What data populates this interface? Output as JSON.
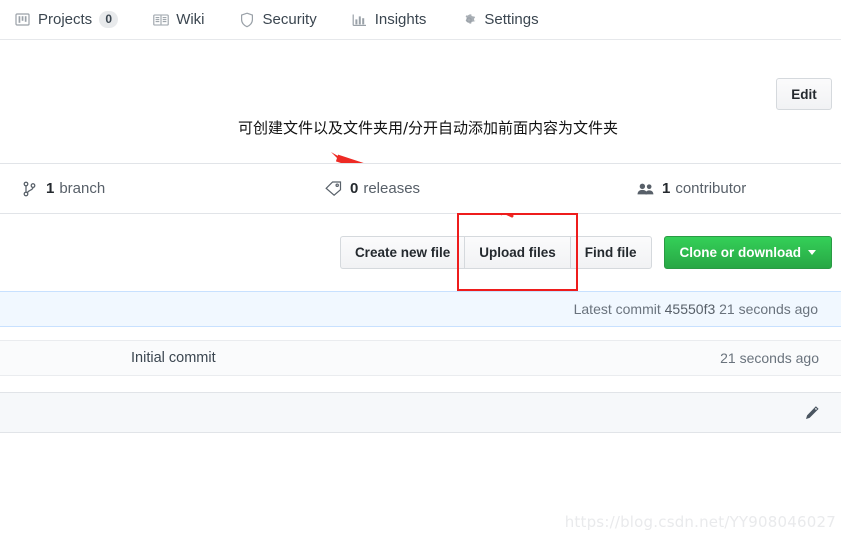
{
  "nav": {
    "items": [
      {
        "label": "Projects",
        "icon": "project-board-icon",
        "count": "0"
      },
      {
        "label": "Wiki",
        "icon": "book-icon"
      },
      {
        "label": "Security",
        "icon": "shield-icon"
      },
      {
        "label": "Insights",
        "icon": "graph-icon"
      },
      {
        "label": "Settings",
        "icon": "gear-icon"
      }
    ]
  },
  "toolbar": {
    "edit_label": "Edit"
  },
  "annotation": {
    "text": "可创建文件以及文件夹用/分开自动添加前面内容为文件夹",
    "arrow_color": "#ee2a24",
    "highlight_color": "#ee1c1c"
  },
  "numbers": {
    "branch": {
      "count": "1",
      "label": "branch",
      "icon": "git-branch-icon"
    },
    "releases": {
      "count": "0",
      "label": "releases",
      "icon": "tag-icon"
    },
    "contributors": {
      "count": "1",
      "label": "contributor",
      "icon": "people-icon"
    }
  },
  "actions": {
    "create_new_file": "Create new file",
    "upload_files": "Upload files",
    "find_file": "Find file",
    "clone_or_download": "Clone or download",
    "clone_button_color": "#28a745"
  },
  "commit": {
    "latest_prefix": "Latest commit",
    "sha": "45550f3",
    "latest_time": "21 seconds ago",
    "message": "Initial commit",
    "time": "21 seconds ago"
  },
  "readme": {
    "edit_icon": "pencil-icon"
  },
  "watermark": {
    "text": "https://blog.csdn.net/YY908046027"
  }
}
